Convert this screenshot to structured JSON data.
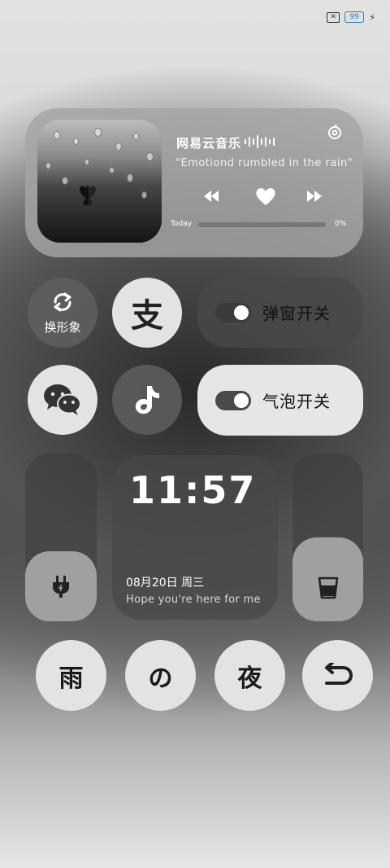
{
  "status_bar": {
    "sim_icon": "no-sim-icon",
    "battery_level": "99",
    "charging_icon": "bolt-icon"
  },
  "music": {
    "app_name": "网易云音乐",
    "lyric": "\"Emotiond rumbled in the rain\"",
    "progress_label": "Today",
    "progress_value": "0%",
    "progress": 0,
    "icons": [
      "netease-logo-icon",
      "previous-icon",
      "heart-icon",
      "next-icon",
      "waveform-icon"
    ]
  },
  "row1": {
    "change_label": "换形象",
    "alipay_glyph": "支",
    "toggle1_label": "弹窗开关"
  },
  "row2": {
    "wechat_icon": "wechat-icon",
    "tiktok_icon": "tiktok-icon",
    "toggle2_label": "气泡开关"
  },
  "clock": {
    "time": "11:57",
    "date": "08月20日  周三",
    "quote": "Hope you're here for me"
  },
  "bottom": {
    "btn1": "雨",
    "btn2": "の",
    "btn3": "夜",
    "back_icon": "undo-arrow-icon"
  },
  "colors": {
    "accent": "#2f7fb0",
    "card": "#a5a5a5",
    "dark": "#5f5f5f",
    "light": "#e3e3e3"
  }
}
